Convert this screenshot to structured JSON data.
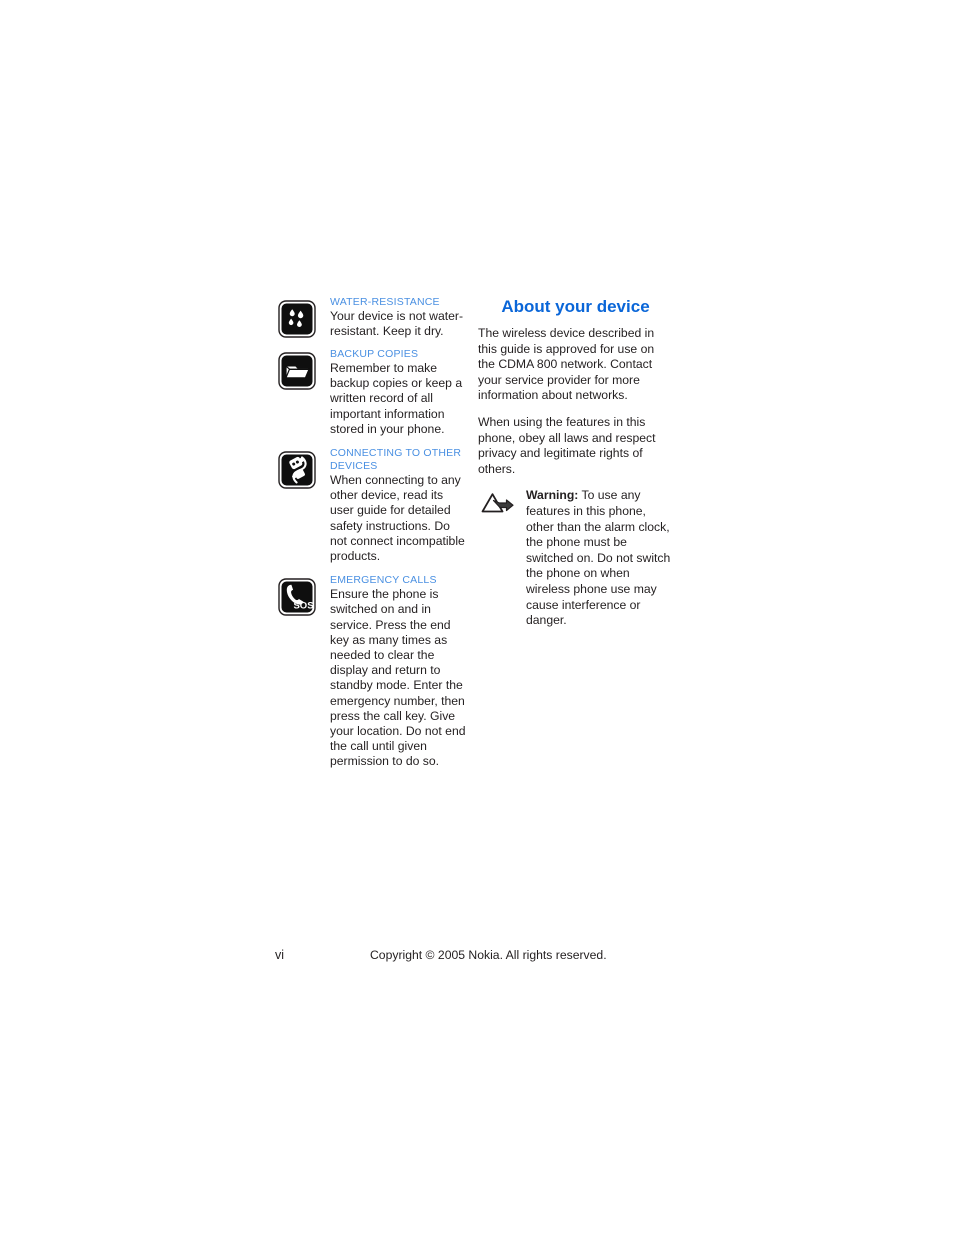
{
  "page": {
    "folio": "vi",
    "copyright": "Copyright © 2005 Nokia. All rights reserved.",
    "heading_color": "#0a66d8",
    "subheading_color": "#4a90e2",
    "body_color": "#231f20"
  },
  "left_column": {
    "notes": [
      {
        "icon": "water-drops-icon",
        "heading": "WATER-RESISTANCE",
        "body": "Your device is not water-resistant. Keep it dry."
      },
      {
        "icon": "folder-backup-icon",
        "heading": "BACKUP COPIES",
        "body": "Remember to make backup copies or keep a written record of all important information stored in your phone."
      },
      {
        "icon": "plug-connector-icon",
        "heading": "CONNECTING TO OTHER DEVICES",
        "body": "When connecting to any other device, read its user guide for detailed safety instructions. Do not connect incompatible products."
      },
      {
        "icon": "emergency-sos-phone-icon",
        "heading": "EMERGENCY CALLS",
        "body": "Ensure the phone is switched on and in service. Press the end key as many times as needed to clear the display and return to standby mode. Enter the emergency number, then press the call key. Give your location. Do not end the call until given permission to do so."
      }
    ]
  },
  "right_column": {
    "title": "About your device",
    "paragraphs": [
      "The wireless device described in this guide is approved for use on the CDMA 800 network. Contact your service provider for more information about networks.",
      "When using the features in this phone, obey all laws and respect privacy and legitimate rights of others."
    ],
    "warning": {
      "icon": "warning-triangle-arrow-icon",
      "label": "Warning:",
      "text": " To use any features in this phone, other than the alarm clock, the phone must be switched on. Do not switch the phone on when wireless phone use may cause interference or danger."
    }
  }
}
